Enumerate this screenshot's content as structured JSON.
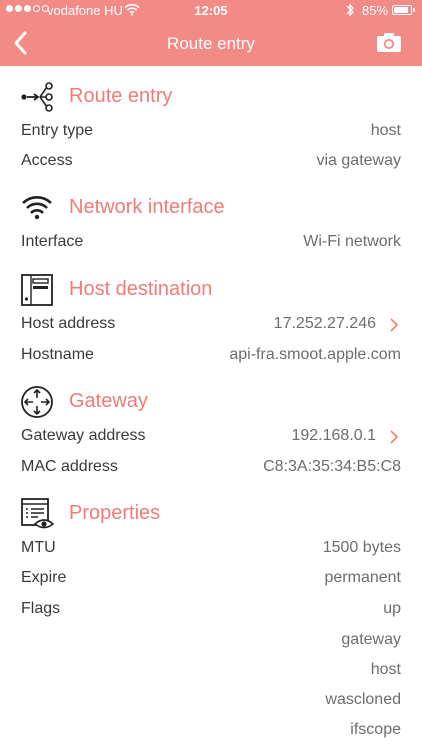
{
  "status_bar": {
    "carrier": "vodafone HU",
    "time": "12:05",
    "battery_percent": "85%",
    "battery_level": 0.85,
    "signal_bars_filled": 3,
    "signal_bars_total": 5
  },
  "nav": {
    "title": "Route entry",
    "accent": "#f28a86"
  },
  "sections": {
    "route": {
      "title": "Route entry",
      "icon": "route-nodes-icon",
      "entry_type_label": "Entry type",
      "entry_type_value": "host",
      "access_label": "Access",
      "access_value": "via gateway"
    },
    "network": {
      "title": "Network interface",
      "icon": "wifi-icon",
      "interface_label": "Interface",
      "interface_value": "Wi-Fi network"
    },
    "host": {
      "title": "Host destination",
      "icon": "server-icon",
      "address_label": "Host address",
      "address_value": "17.252.27.246",
      "hostname_label": "Hostname",
      "hostname_value": "api-fra.smoot.apple.com"
    },
    "gateway": {
      "title": "Gateway",
      "icon": "router-arrows-icon",
      "address_label": "Gateway address",
      "address_value": "192.168.0.1",
      "mac_label": "MAC address",
      "mac_value": "C8:3A:35:34:B5:C8"
    },
    "properties": {
      "title": "Properties",
      "icon": "document-eye-icon",
      "mtu_label": "MTU",
      "mtu_value": "1500 bytes",
      "expire_label": "Expire",
      "expire_value": "permanent",
      "flags_label": "Flags",
      "flags": [
        "up",
        "gateway",
        "host",
        "wascloned",
        "ifscope"
      ]
    }
  }
}
